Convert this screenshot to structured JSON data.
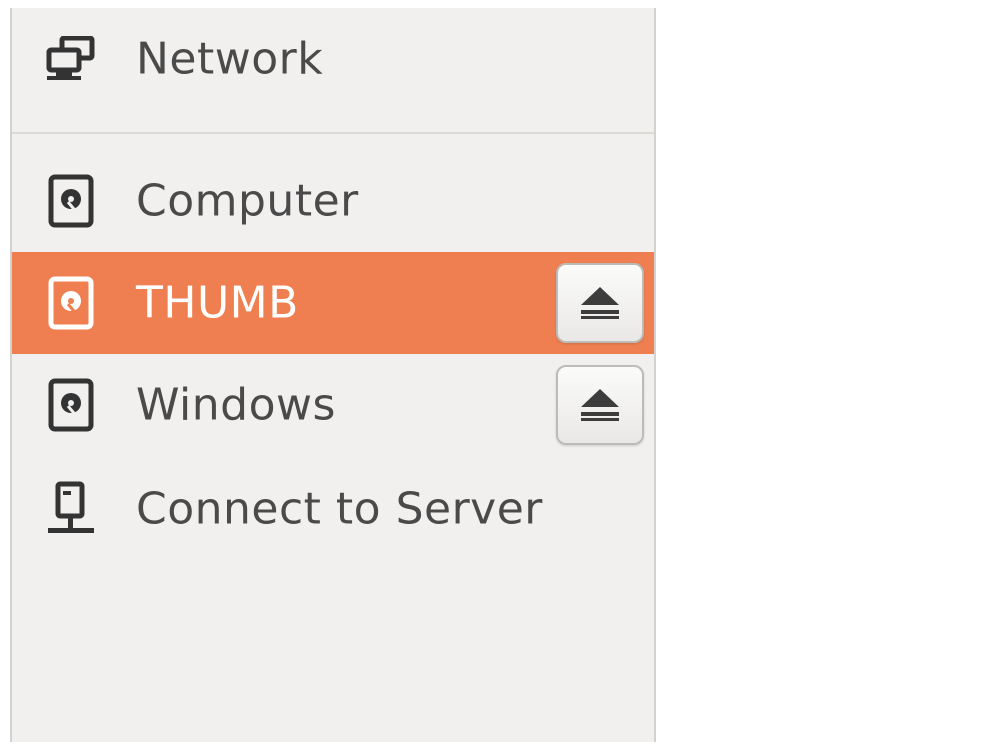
{
  "sidebar": {
    "network": {
      "label": "Network",
      "icon": "network-icon"
    },
    "devices": [
      {
        "label": "Computer",
        "icon": "drive-icon",
        "selected": false,
        "ejectable": false
      },
      {
        "label": "THUMB",
        "icon": "drive-icon",
        "selected": true,
        "ejectable": true
      },
      {
        "label": "Windows",
        "icon": "drive-icon",
        "selected": false,
        "ejectable": true
      }
    ],
    "connect": {
      "label": "Connect to Server",
      "icon": "server-icon"
    }
  },
  "colors": {
    "selection": "#ef7f51",
    "panel_bg": "#f1f0ef",
    "text": "#4a4a4a"
  }
}
